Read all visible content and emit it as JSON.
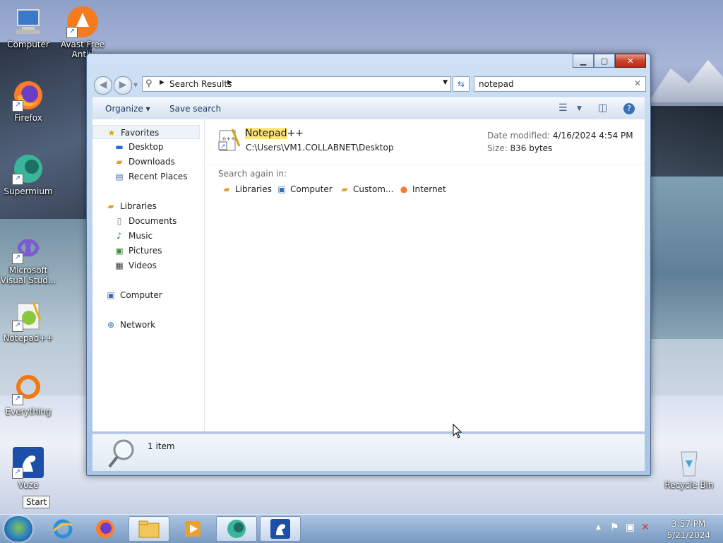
{
  "desktop": {
    "icons": [
      {
        "label": "Computer",
        "icon": "computer-icon",
        "shortcut": false
      },
      {
        "label": "Avast Free Antiv",
        "icon": "avast-icon",
        "shortcut": true
      },
      {
        "label": "Firefox",
        "icon": "firefox-icon",
        "shortcut": true
      },
      {
        "label": "Supermium",
        "icon": "supermium-icon",
        "shortcut": true
      },
      {
        "label": "Microsoft Visual Stud...",
        "icon": "visual-studio-icon",
        "shortcut": true
      },
      {
        "label": "Notepad++",
        "icon": "notepadpp-icon",
        "shortcut": true
      },
      {
        "label": "Everything",
        "icon": "everything-icon",
        "shortcut": true
      },
      {
        "label": "Vuze",
        "icon": "vuze-icon",
        "shortcut": true
      },
      {
        "label": "Recycle Bin",
        "icon": "recycle-bin-icon",
        "shortcut": false
      }
    ]
  },
  "window": {
    "caption_buttons": [
      "minimize",
      "maximize",
      "close"
    ],
    "address": {
      "segment": "Search Results"
    },
    "search": {
      "value": "notepad"
    },
    "toolbar": {
      "organize": "Organize",
      "save_search": "Save search"
    },
    "nav": {
      "favorites": "Favorites",
      "favorites_items": [
        "Desktop",
        "Downloads",
        "Recent Places"
      ],
      "libraries": "Libraries",
      "libraries_items": [
        "Documents",
        "Music",
        "Pictures",
        "Videos"
      ],
      "computer": "Computer",
      "network": "Network"
    },
    "result": {
      "name_highlight": "Notepad",
      "name_rest": "++",
      "path": "C:\\Users\\VM1.COLLABNET\\Desktop",
      "date_label": "Date modified:",
      "date_value": "4/16/2024 4:54 PM",
      "size_label": "Size:",
      "size_value": "836 bytes"
    },
    "search_again": {
      "label": "Search again in:",
      "items": [
        "Libraries",
        "Computer",
        "Custom...",
        "Internet"
      ]
    },
    "details": {
      "count": "1 item"
    }
  },
  "taskbar": {
    "tooltip": "Start",
    "time": "3:57 PM",
    "date": "5/21/2024"
  }
}
